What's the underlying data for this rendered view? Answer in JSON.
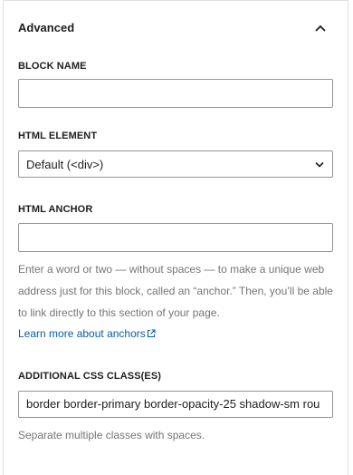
{
  "panel": {
    "title": "Advanced"
  },
  "block_name": {
    "label": "BLOCK NAME",
    "value": ""
  },
  "html_element": {
    "label": "HTML ELEMENT",
    "selected": "Default (<div>)"
  },
  "html_anchor": {
    "label": "HTML ANCHOR",
    "value": "",
    "help_line1": "Enter a word or two — without spaces — to make a unique web",
    "help_line2": "address just for this block, called an “anchor.” Then, you’ll be able",
    "help_line3": "to link directly to this section of your page.",
    "learn_more": "Learn more about anchors"
  },
  "css_classes": {
    "label": "ADDITIONAL CSS CLASS(ES)",
    "value": "border border-primary border-opacity-25 shadow-sm rou",
    "help": "Separate multiple classes with spaces."
  },
  "colors": {
    "link": "#0a5ca8",
    "help_text": "#757575",
    "border": "#949494"
  },
  "icons": {
    "collapse": "chevron-up-icon",
    "dropdown": "chevron-down-icon",
    "external": "external-link-icon"
  }
}
